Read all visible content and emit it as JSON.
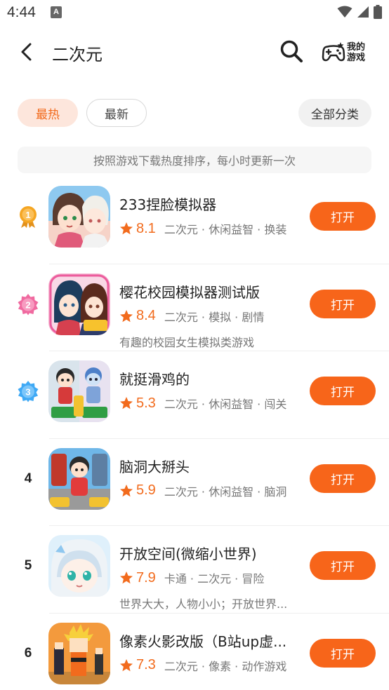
{
  "status_bar": {
    "time": "4:44",
    "notification_letter": "A"
  },
  "header": {
    "title": "二次元",
    "my_games_label": "我的游戏"
  },
  "filters": {
    "hot": "最热",
    "newest": "最新",
    "all_categories": "全部分类"
  },
  "notice": "按照游戏下载热度排序，每小时更新一次",
  "colors": {
    "accent": "#f7651a",
    "hot_chip_bg": "#fde6dc",
    "gold": "#f5a623",
    "pink": "#f06aa0",
    "blue": "#3fa9f5"
  },
  "games": [
    {
      "rank": "1",
      "medal": "gold",
      "name": "233捏脸模拟器",
      "score": "8.1",
      "tags": "二次元 · 休闲益智 · 换装",
      "desc": "",
      "button": "打开"
    },
    {
      "rank": "2",
      "medal": "pink",
      "name": "樱花校园模拟器测试版",
      "score": "8.4",
      "tags": "二次元 · 模拟 · 剧情",
      "desc": "有趣的校园女生模拟类游戏",
      "button": "打开"
    },
    {
      "rank": "3",
      "medal": "blue",
      "name": "就挺滑鸡的",
      "score": "5.3",
      "tags": "二次元 · 休闲益智 · 闯关",
      "desc": "",
      "button": "打开"
    },
    {
      "rank": "4",
      "medal": "",
      "name": "脑洞大掰头",
      "score": "5.9",
      "tags": "二次元 · 休闲益智 · 脑洞",
      "desc": "",
      "button": "打开"
    },
    {
      "rank": "5",
      "medal": "",
      "name": "开放空间(微缩小世界)",
      "score": "7.9",
      "tags": "卡通 · 二次元 · 冒险",
      "desc": "世界大大，人物小小；开放世界...",
      "button": "打开"
    },
    {
      "rank": "6",
      "medal": "",
      "name": "像素火影改版（B站up虚...",
      "score": "7.3",
      "tags": "二次元 · 像素 · 动作游戏",
      "desc": "",
      "button": "打开"
    }
  ]
}
